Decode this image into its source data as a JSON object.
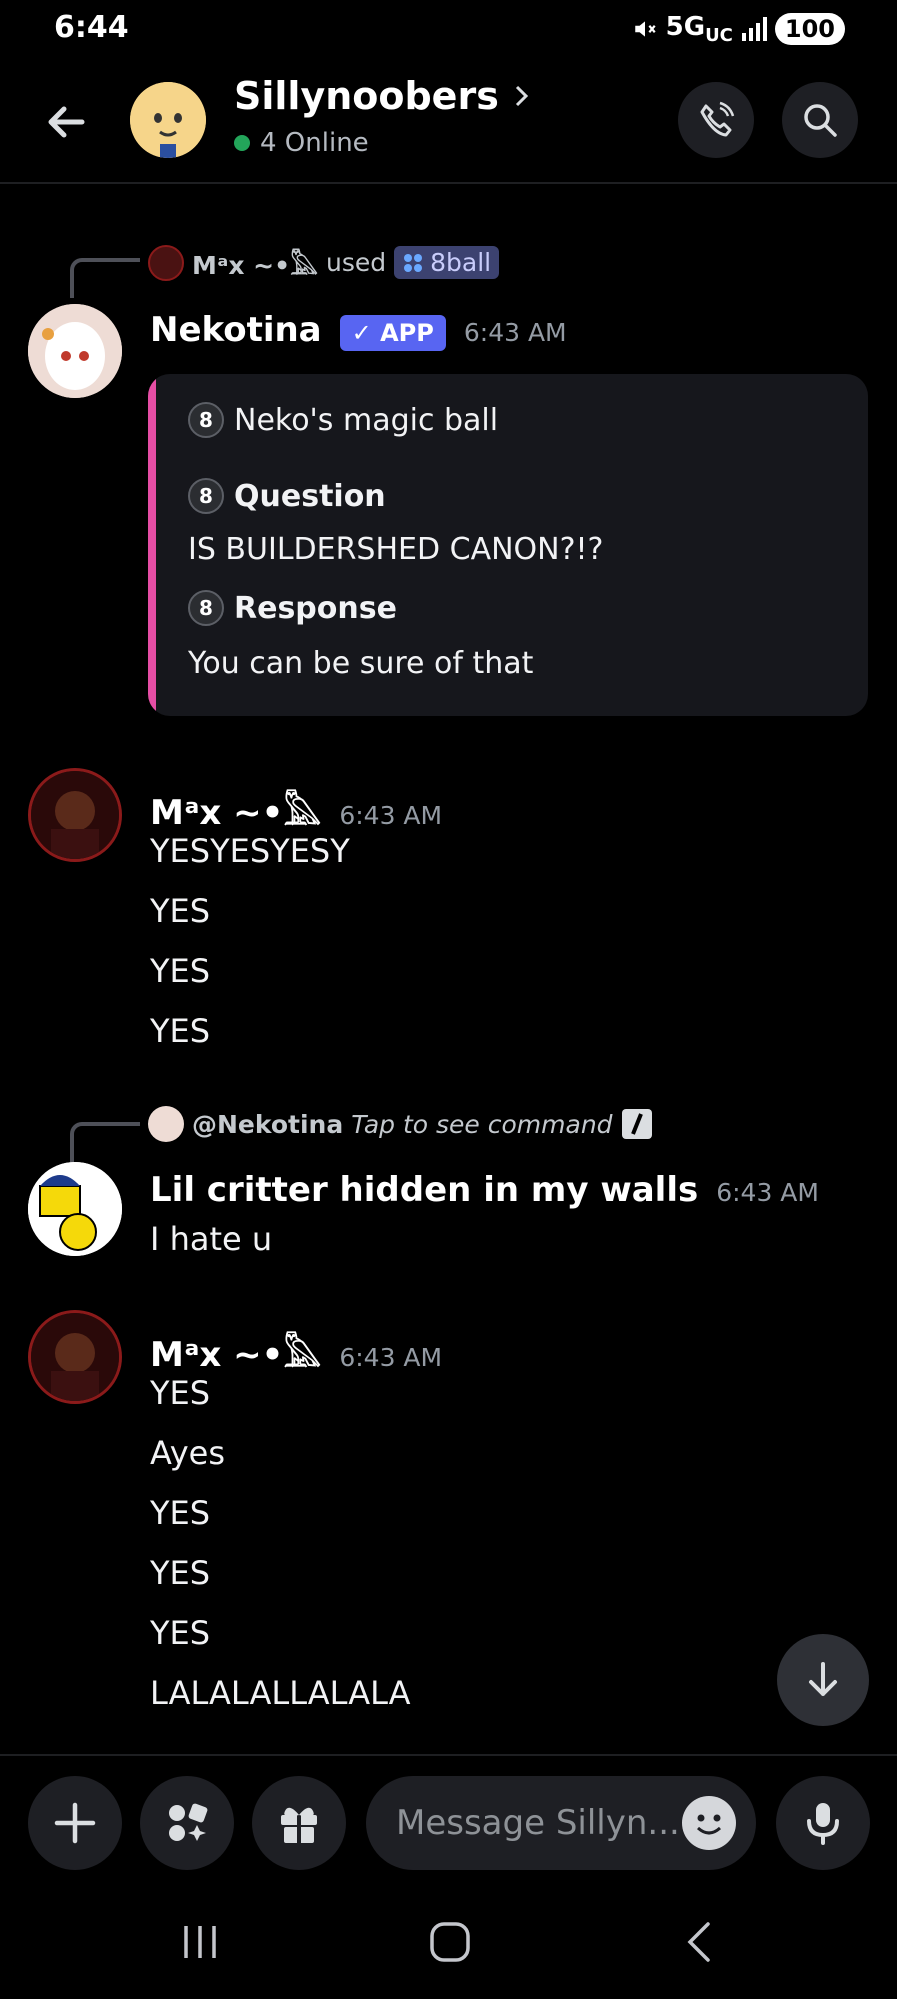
{
  "status": {
    "time": "6:44",
    "network": "5G",
    "network_sub": "UC",
    "battery": "100"
  },
  "header": {
    "title": "Sillynoobers",
    "online": "4 Online"
  },
  "messages": [
    {
      "reply": {
        "user": "Mᵃx ~•𓅓",
        "action": "used",
        "command": "8ball"
      },
      "author": "Nekotina",
      "badge": "✓ APP",
      "time": "6:43 AM",
      "embed": {
        "title": "Neko's magic ball",
        "question_label": "Question",
        "question": "IS BUILDERSHED CANON?!?",
        "response_label": "Response",
        "response": "You can be sure of that"
      }
    },
    {
      "author": "Mᵃx ~•𓅓",
      "time": "6:43 AM",
      "lines": [
        "YESYESYESY",
        "YES",
        "YES",
        "YES"
      ]
    },
    {
      "reply": {
        "user": "@Nekotina",
        "hint": "Tap to see command"
      },
      "author": "Lil critter hidden in my walls",
      "time": "6:43 AM",
      "lines": [
        "I hate u"
      ]
    },
    {
      "author": "Mᵃx ~•𓅓",
      "time": "6:43 AM",
      "lines": [
        "YES",
        "Ayes",
        "YES",
        "YES",
        "YES",
        "LALALALLALALA"
      ]
    }
  ],
  "input": {
    "placeholder": "Message Sillyn..."
  },
  "icons": {
    "back": "arrow-left-icon",
    "call": "phone-icon",
    "search": "search-icon",
    "plus": "plus-icon",
    "apps": "apps-icon",
    "gift": "gift-icon",
    "emoji": "emoji-icon",
    "mic": "microphone-icon",
    "scroll": "arrow-down-icon"
  },
  "colors": {
    "background": "#000000",
    "accent": "#5865f2",
    "embed_bar": "#e64ea5",
    "online": "#23a55a"
  }
}
